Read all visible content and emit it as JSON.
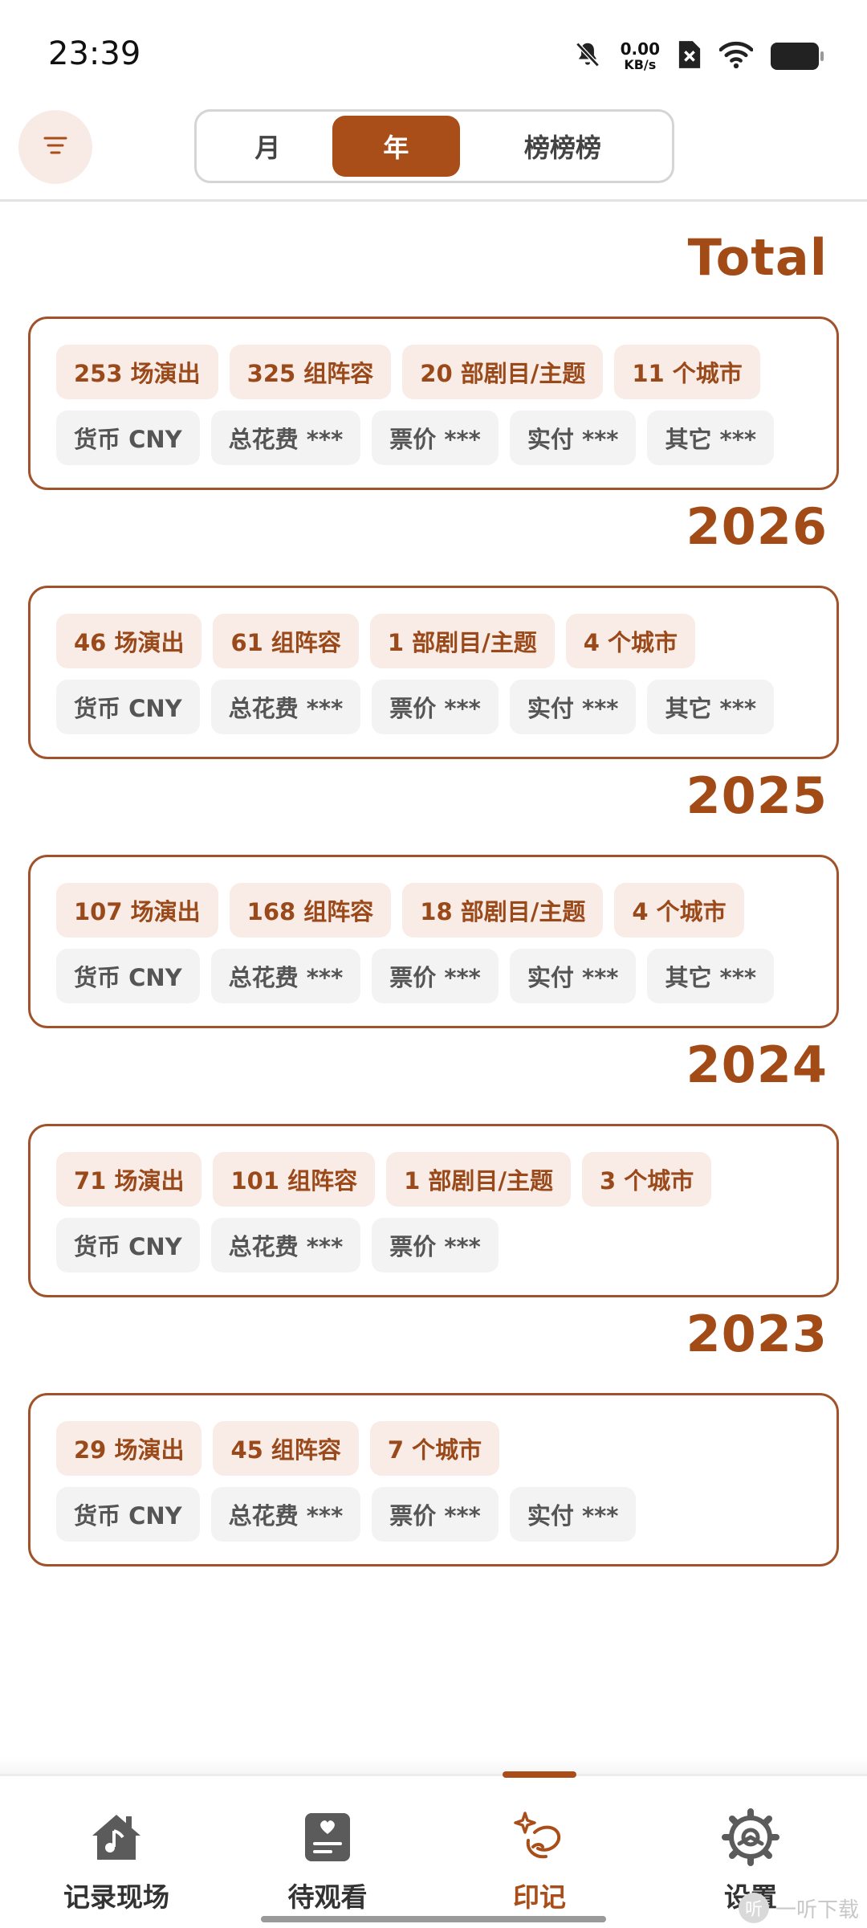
{
  "status_bar": {
    "time": "23:39",
    "net_speed_value": "0.00",
    "net_speed_unit": "KB/s",
    "icons": [
      "mute-bell-icon",
      "no-sim-icon",
      "wifi-icon",
      "battery-icon"
    ]
  },
  "header": {
    "filter_icon": "filter-icon",
    "segments": [
      {
        "label": "月",
        "selected": false
      },
      {
        "label": "年",
        "selected": true
      },
      {
        "label": "榜榜榜",
        "selected": false
      }
    ]
  },
  "sections": [
    {
      "title": "Total",
      "stats": [
        "253 场演出",
        "325 组阵容",
        "20 部剧目/主题",
        "11 个城市"
      ],
      "money": [
        "货币 CNY",
        "总花费 ***",
        "票价 ***",
        "实付 ***",
        "其它 ***"
      ]
    },
    {
      "title": "2026",
      "stats": [
        "46 场演出",
        "61 组阵容",
        "1 部剧目/主题",
        "4 个城市"
      ],
      "money": [
        "货币 CNY",
        "总花费 ***",
        "票价 ***",
        "实付 ***",
        "其它 ***"
      ]
    },
    {
      "title": "2025",
      "stats": [
        "107 场演出",
        "168 组阵容",
        "18 部剧目/主题",
        "4 个城市"
      ],
      "money": [
        "货币 CNY",
        "总花费 ***",
        "票价 ***",
        "实付 ***",
        "其它 ***"
      ]
    },
    {
      "title": "2024",
      "stats": [
        "71 场演出",
        "101 组阵容",
        "1 部剧目/主题",
        "3 个城市"
      ],
      "money": [
        "货币 CNY",
        "总花费 ***",
        "票价 ***"
      ]
    },
    {
      "title": "2023",
      "stats": [
        "29 场演出",
        "45 组阵容",
        "7 个城市"
      ],
      "money": [
        "货币 CNY",
        "总花费 ***",
        "票价 ***",
        "实付 ***"
      ]
    }
  ],
  "bottom_nav": {
    "items": [
      {
        "label": "记录现场",
        "icon": "house-music-icon",
        "active": false
      },
      {
        "label": "待观看",
        "icon": "ticket-heart-icon",
        "active": false
      },
      {
        "label": "印记",
        "icon": "sparkle-orbit-icon",
        "active": true
      },
      {
        "label": "设置",
        "icon": "gear-icon",
        "active": false
      }
    ]
  },
  "watermark": {
    "text": "一听下载",
    "logo_char": "听"
  },
  "colors": {
    "accent": "#a94d19",
    "stat_chip_bg": "#f9ebe5",
    "money_chip_bg": "#f3f3f3"
  }
}
